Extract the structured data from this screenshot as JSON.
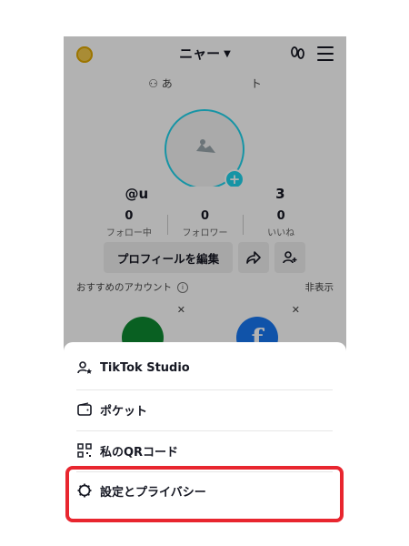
{
  "header": {
    "username": "ニャー"
  },
  "profile": {
    "subline_prefix": "あ",
    "subline_suffix": "ト",
    "handle_prefix": "@u",
    "handle_suffix": "3"
  },
  "stats": [
    {
      "value": "0",
      "label": "フォロー中"
    },
    {
      "value": "0",
      "label": "フォロワー"
    },
    {
      "value": "0",
      "label": "いいね"
    }
  ],
  "buttons": {
    "edit_profile": "プロフィールを編集"
  },
  "recommended": {
    "title": "おすすめのアカウント",
    "hide": "非表示"
  },
  "menu": [
    {
      "label": "TikTok Studio",
      "icon": "person-star-icon"
    },
    {
      "label": "ポケット",
      "icon": "wallet-icon"
    },
    {
      "label": "私のQRコード",
      "icon": "qr-code-icon"
    },
    {
      "label": "設定とプライバシー",
      "icon": "gear-icon"
    }
  ],
  "colors": {
    "highlight": "#e8262f",
    "accent": "#20d5ec"
  }
}
